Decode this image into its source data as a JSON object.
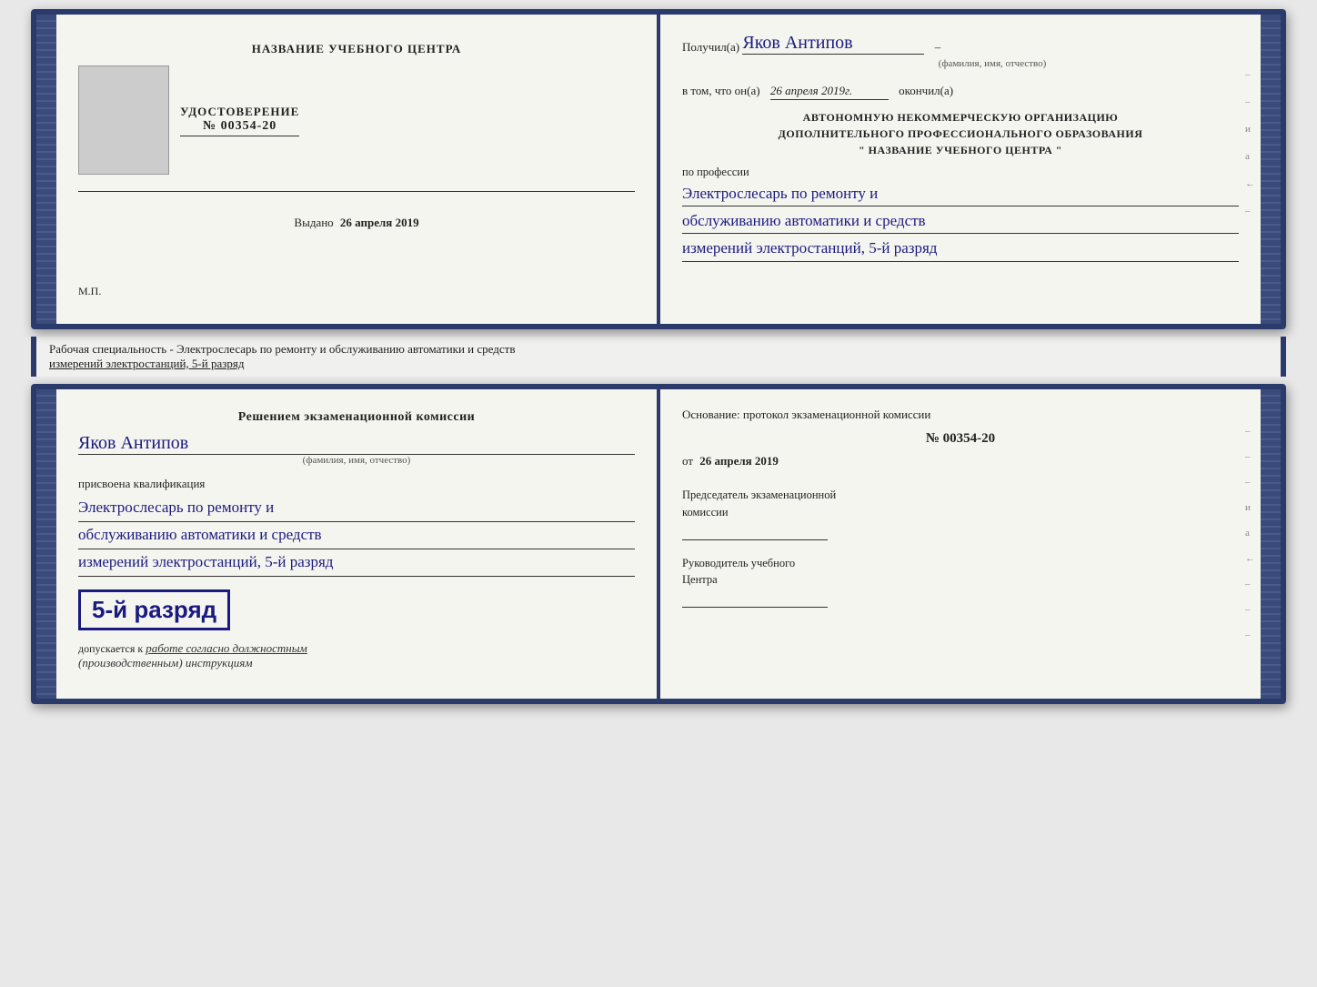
{
  "top_spread": {
    "left_page": {
      "center_title": "НАЗВАНИЕ УЧЕБНОГО ЦЕНТРА",
      "cert_label": "УДОСТОВЕРЕНИЕ",
      "cert_number": "№ 00354-20",
      "issued_label": "Выдано",
      "issued_date": "26 апреля 2019",
      "stamp_label": "М.П."
    },
    "right_page": {
      "recipient_prefix": "Получил(а)",
      "recipient_name": "Яков Антипов",
      "fio_hint": "(фамилия, имя, отчество)",
      "certifies_line1": "в том, что он(а)",
      "certifies_date": "26 апреля 2019г.",
      "certifies_suffix": "окончил(а)",
      "org_line1": "АВТОНОМНУЮ НЕКОММЕРЧЕСКУЮ ОРГАНИЗАЦИЮ",
      "org_line2": "ДОПОЛНИТЕЛЬНОГО ПРОФЕССИОНАЛЬНОГО ОБРАЗОВАНИЯ",
      "org_line3": "\"  НАЗВАНИЕ УЧЕБНОГО ЦЕНТРА  \"",
      "profession_label": "по профессии",
      "profession_line1": "Электрослесарь по ремонту и",
      "profession_line2": "обслуживанию автоматики и средств",
      "profession_line3": "измерений электростанций, 5-й разряд",
      "side_marks": [
        "–",
        "–",
        "и",
        "а",
        "←",
        "–"
      ]
    }
  },
  "label_strip": {
    "text": "Рабочая специальность - Электрослесарь по ремонту и обслуживанию автоматики и средств",
    "underline_text": "измерений электростанций, 5-й разряд"
  },
  "bottom_spread": {
    "left_page": {
      "commission_title_line1": "Решением экзаменационной комиссии",
      "recipient_name": "Яков Антипов",
      "fio_hint": "(фамилия, имя, отчество)",
      "qualification_label": "присвоена квалификация",
      "qualification_line1": "Электрослесарь по ремонту и",
      "qualification_line2": "обслуживанию автоматики и средств",
      "qualification_line3": "измерений электростанций, 5-й разряд",
      "rank_badge": "5-й разряд",
      "allowed_prefix": "допускается к",
      "allowed_handwritten": "работе согласно должностным",
      "allowed_line2": "(производственным) инструкциям"
    },
    "right_page": {
      "basis_label": "Основание: протокол экзаменационной комиссии",
      "protocol_number": "№  00354-20",
      "protocol_date_prefix": "от",
      "protocol_date": "26 апреля 2019",
      "chairman_title_line1": "Председатель экзаменационной",
      "chairman_title_line2": "комиссии",
      "director_title_line1": "Руководитель учебного",
      "director_title_line2": "Центра",
      "side_marks": [
        "–",
        "–",
        "–",
        "и",
        "а",
        "←",
        "–",
        "–",
        "–"
      ]
    }
  }
}
